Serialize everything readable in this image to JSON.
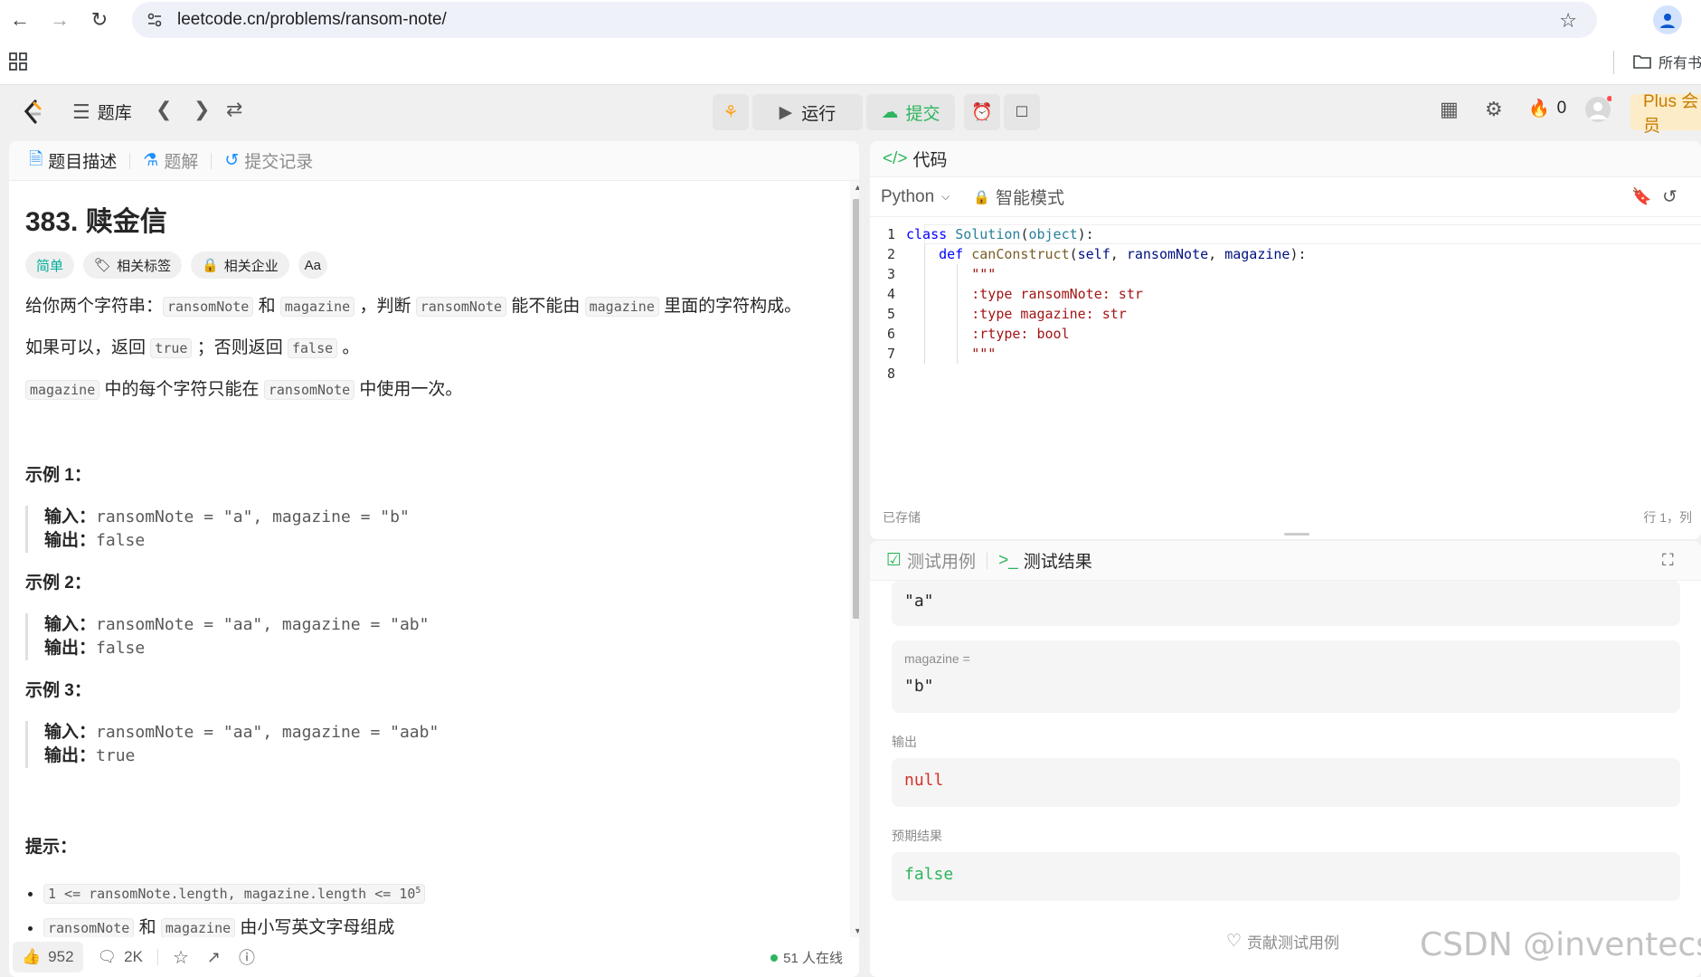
{
  "browser": {
    "url": "leetcode.cn/problems/ransom-note/",
    "bookmarks_label": "所有书"
  },
  "header": {
    "problemset_label": "题库",
    "run_label": "运行",
    "submit_label": "提交",
    "streak_count": "0",
    "plus_label": "Plus 会员"
  },
  "left_tabs": [
    "题目描述",
    "题解",
    "提交记录"
  ],
  "problem": {
    "title": "383. 赎金信",
    "difficulty": "简单",
    "tags_label": "相关标签",
    "companies_label": "相关企业",
    "translate_icon_text": "Aa",
    "desc1": {
      "a": "给你两个字符串：",
      "c1": "ransomNote",
      "b": "和",
      "c2": "magazine",
      "c": "，判断",
      "c3": "ransomNote",
      "d": "能不能由",
      "c4": "magazine",
      "e": "里面的字符构成。"
    },
    "desc2": {
      "a": "如果可以，返回",
      "c1": "true",
      "b": "；否则返回",
      "c2": "false",
      "c": "。"
    },
    "desc3": {
      "c1": "magazine",
      "a": "中的每个字符只能在",
      "c2": "ransomNote",
      "b": "中使用一次。"
    },
    "examples": [
      {
        "title": "示例 1：",
        "input_label": "输入：",
        "input": "ransomNote = \"a\", magazine = \"b\"",
        "output_label": "输出：",
        "output": "false"
      },
      {
        "title": "示例 2：",
        "input_label": "输入：",
        "input": "ransomNote = \"aa\", magazine = \"ab\"",
        "output_label": "输出：",
        "output": "false"
      },
      {
        "title": "示例 3：",
        "input_label": "输入：",
        "input": "ransomNote = \"aa\", magazine = \"aab\"",
        "output_label": "输出：",
        "output": "true"
      }
    ],
    "hints_title": "提示：",
    "hint1_code": "1 <= ransomNote.length, magazine.length <= 10",
    "hint1_sup": "5",
    "hint2": {
      "c1": "ransomNote",
      "a": "和",
      "c2": "magazine",
      "b": "由小写英文字母组成"
    }
  },
  "footer": {
    "likes": "952",
    "comments": "2K",
    "online": "51 人在线"
  },
  "code_panel": {
    "tab_label": "代码",
    "language": "Python",
    "mode_label": "智能模式",
    "saved_label": "已存储",
    "cursor_label": "行 1，列",
    "lines": [
      "class Solution(object):",
      "    def canConstruct(self, ransomNote, magazine):",
      "        \"\"\"",
      "        :type ransomNote: str",
      "        :type magazine: str",
      "        :rtype: bool",
      "        \"\"\"",
      ""
    ]
  },
  "test_panel": {
    "tab_cases": "测试用例",
    "tab_results": "测试结果",
    "input1_value": "\"a\"",
    "magazine_label": "magazine =",
    "magazine_value": "\"b\"",
    "output_label": "输出",
    "output_value": "null",
    "expected_label": "预期结果",
    "expected_value": "false",
    "contribute_label": "贡献测试用例"
  },
  "watermark": "CSDN @inventecsh",
  "colors": {
    "accent_green": "#2db55d",
    "easy": "#00af9b",
    "null_red": "#d4302b",
    "plus_orange": "#c77d00"
  }
}
